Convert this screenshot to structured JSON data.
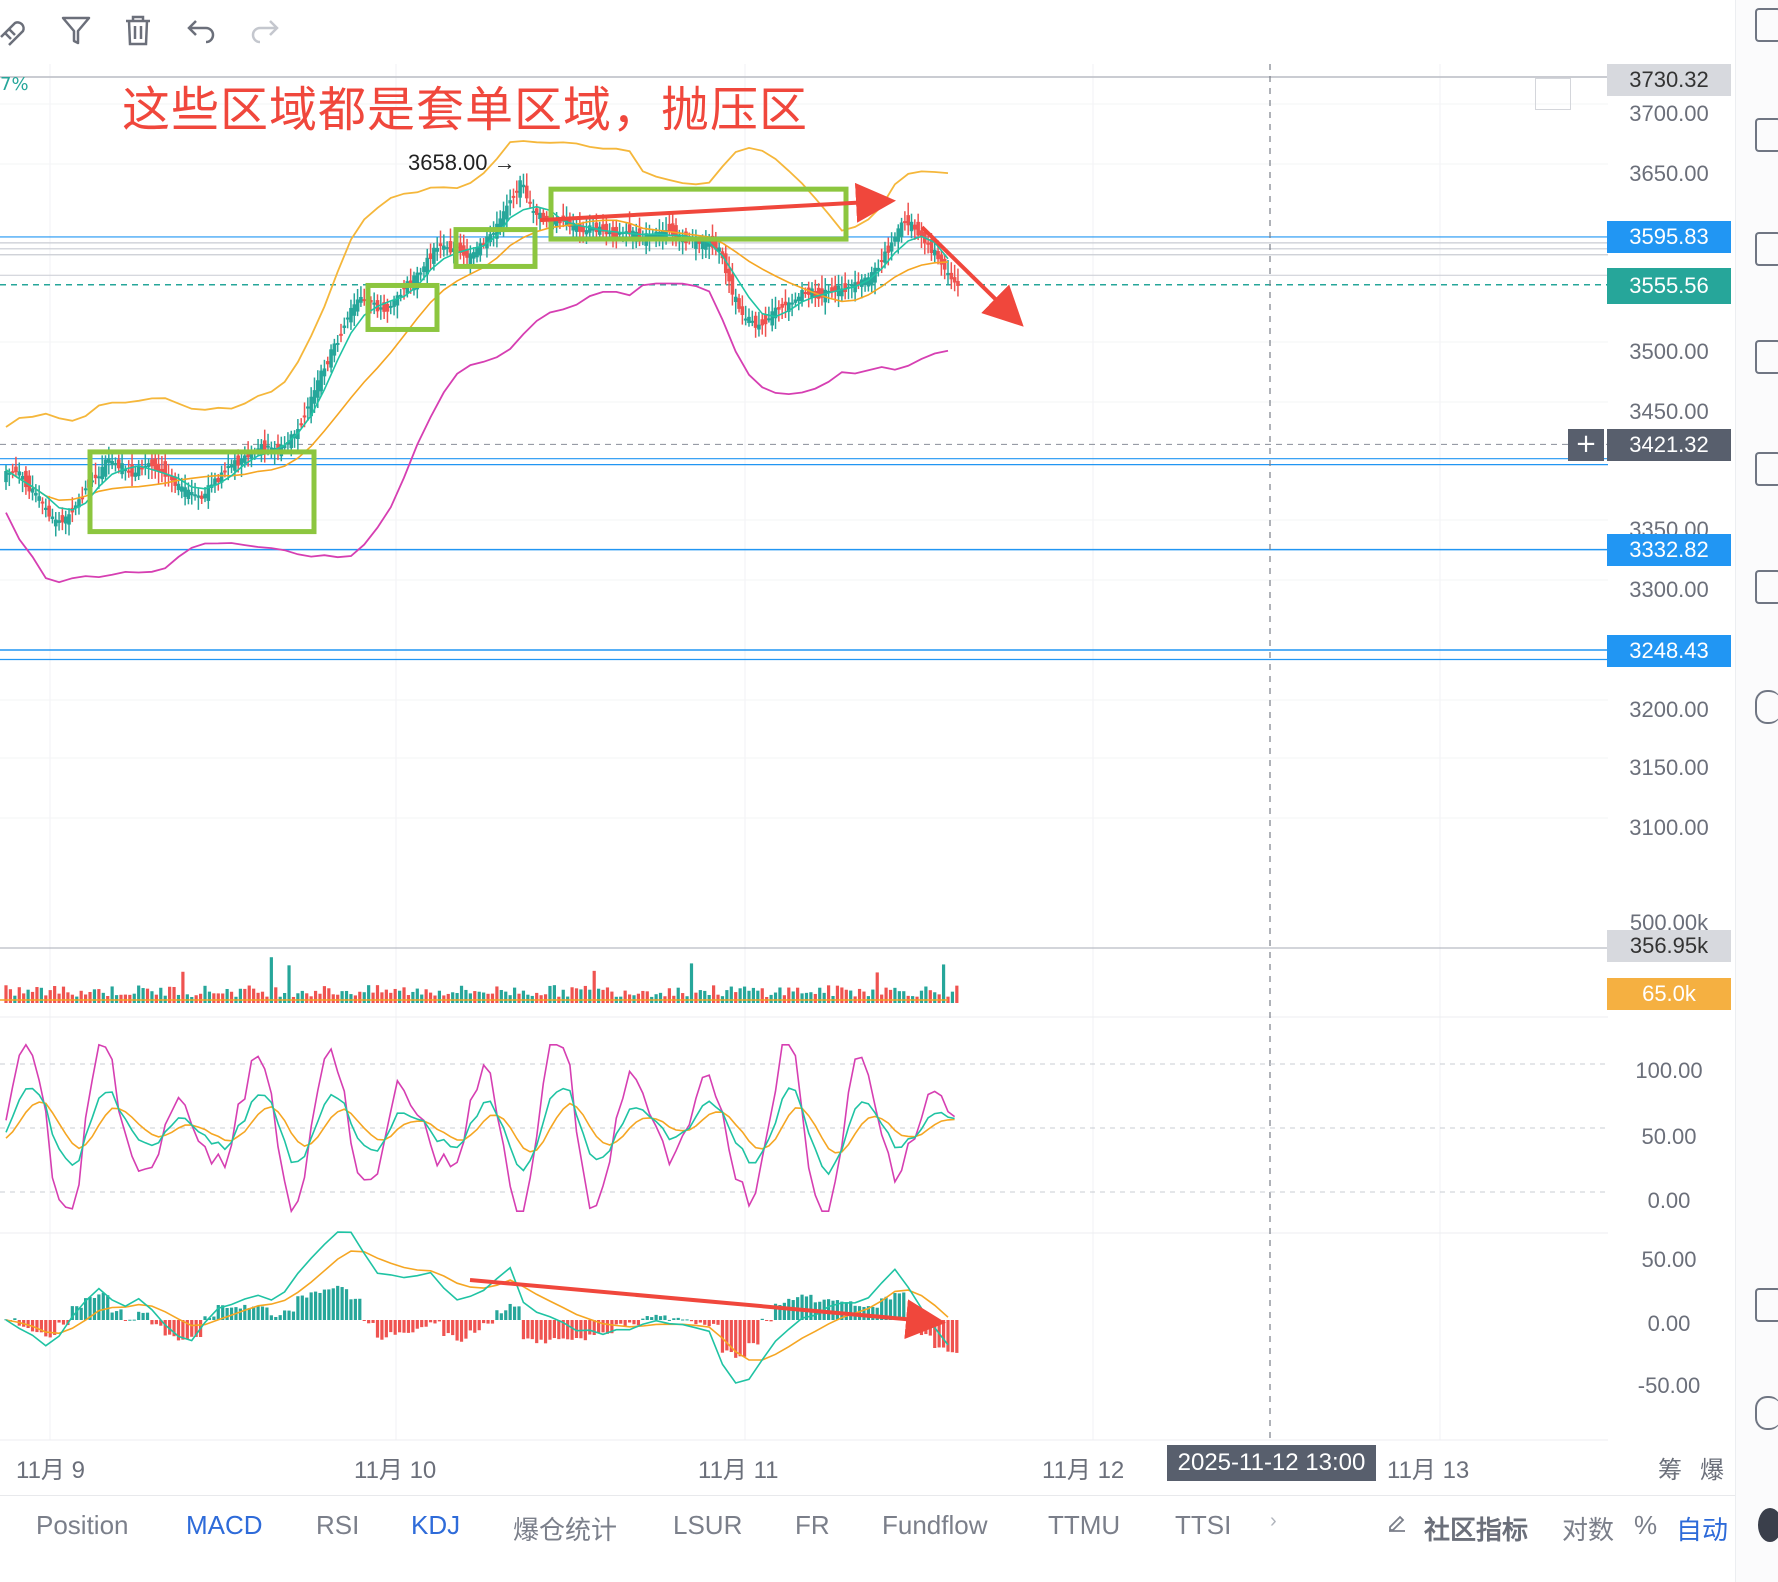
{
  "toolbar": {
    "icons": [
      "magnet-icon",
      "filter-icon",
      "trash-icon",
      "undo-icon",
      "redo-icon"
    ]
  },
  "chart_header": {
    "percent_fragment": "7%"
  },
  "annotation": {
    "text": "这些区域都是套单区域，抛压区",
    "color": "#f0473c"
  },
  "high_marker": {
    "text": "3658.00 →"
  },
  "price_axis": {
    "ticks": [
      "3700.00",
      "3650.00",
      "3500.00",
      "3450.00",
      "3350.00",
      "3300.00",
      "3200.00",
      "3150.00",
      "3100.00",
      "500.00k"
    ],
    "labels": {
      "top": "3730.32",
      "level_1": "3595.83",
      "current": "3555.56",
      "crosshair": "3421.32",
      "level_2": "3332.82",
      "level_3": "3248.43",
      "volume": "356.95k",
      "volume_ma": "65.0k"
    }
  },
  "kdj_axis": {
    "ticks": [
      "100.00",
      "50.00",
      "0.00"
    ]
  },
  "macd_axis": {
    "ticks": [
      "50.00",
      "0.00",
      "-50.00"
    ]
  },
  "time_axis": {
    "dates": [
      "11月 9",
      "11月 10",
      "11月 11",
      "11月 12",
      "11月 13"
    ],
    "crosshair_time": "2025-11-12 13:00",
    "right_labels": [
      "筹",
      "爆"
    ]
  },
  "indicator_tabs": {
    "items": [
      "Position",
      "MACD",
      "RSI",
      "KDJ",
      "爆仓统计",
      "LSUR",
      "FR",
      "Fundflow",
      "TTMU",
      "TTSI"
    ],
    "active": [
      "MACD",
      "KDJ"
    ],
    "more": "›",
    "community": "社区指标",
    "log": "对数",
    "percent": "%",
    "auto": "自动"
  },
  "chart_data": {
    "type": "candlestick",
    "symbol_interval": "1h",
    "price_range": [
      3050,
      3760
    ],
    "annotated_high": 3658.0,
    "horizontal_levels": [
      3730.32,
      3595.83,
      3555.56,
      3421.32,
      3332.82,
      3248.43
    ],
    "close_series": [
      3400,
      3385,
      3372,
      3355,
      3360,
      3378,
      3395,
      3410,
      3402,
      3396,
      3405,
      3398,
      3388,
      3380,
      3376,
      3392,
      3404,
      3408,
      3415,
      3420,
      3418,
      3430,
      3455,
      3480,
      3505,
      3530,
      3545,
      3540,
      3535,
      3548,
      3560,
      3575,
      3590,
      3585,
      3580,
      3588,
      3600,
      3620,
      3640,
      3615,
      3610,
      3608,
      3605,
      3600,
      3602,
      3598,
      3600,
      3595,
      3598,
      3600,
      3596,
      3594,
      3590,
      3585,
      3550,
      3525,
      3520,
      3530,
      3540,
      3545,
      3550,
      3548,
      3552,
      3556,
      3560,
      3570,
      3590,
      3610,
      3600,
      3585,
      3570,
      3555
    ],
    "kdj_range": [
      -10,
      110
    ],
    "macd_range": [
      -60,
      60
    ],
    "colors": {
      "up": "#26a69a",
      "down": "#ef5350",
      "green_box": "#8cc63f",
      "arrow": "#f0473c"
    }
  }
}
